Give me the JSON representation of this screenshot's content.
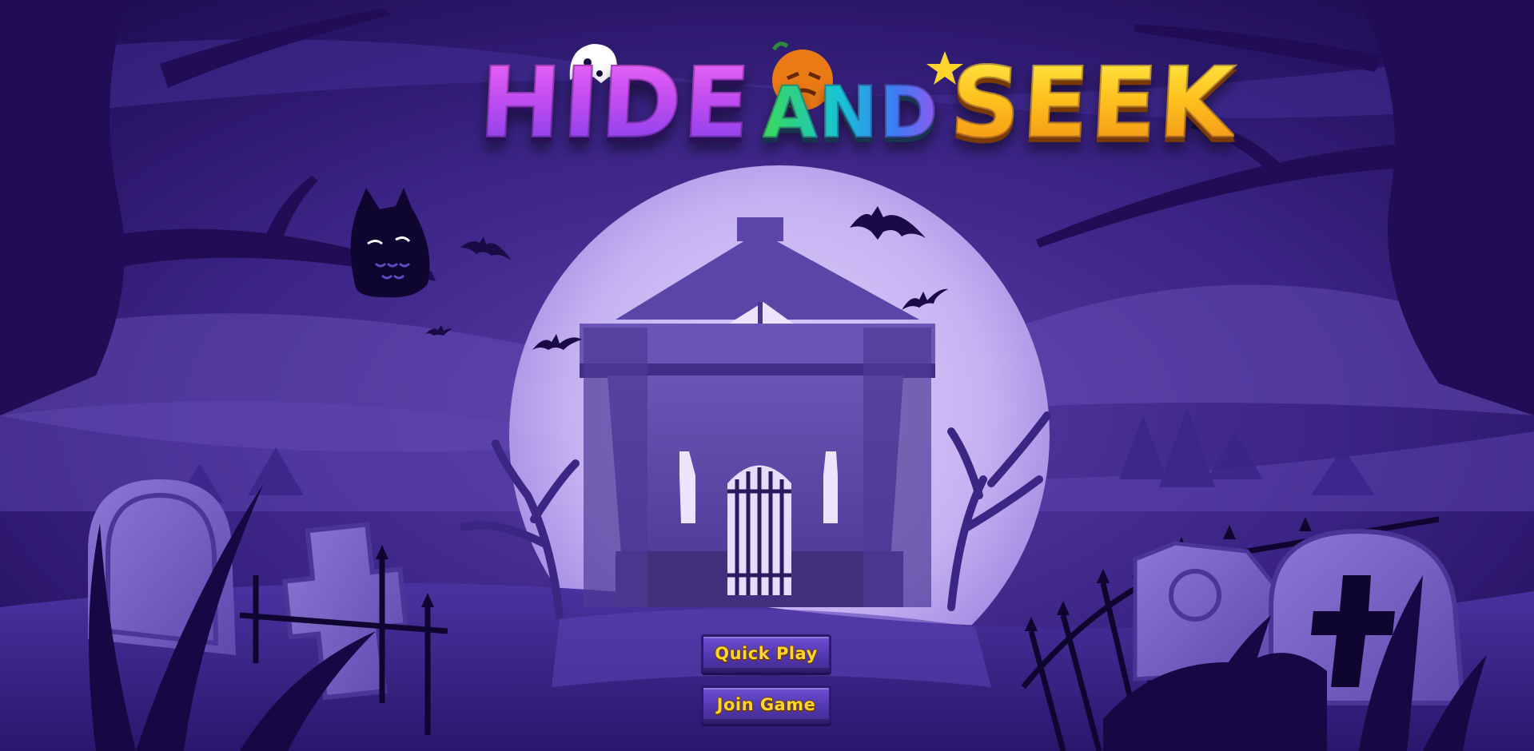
{
  "title": {
    "word1": "HIDE",
    "word2": "AND",
    "word3": "SEEK"
  },
  "menu": {
    "quick_play_label": "Quick Play",
    "join_game_label": "Join Game"
  },
  "colors": {
    "sky": "#1d0b4a",
    "moon": "#c8b4f3",
    "button_fill": "#5338b0",
    "button_text": "#ffd52e"
  },
  "icons": [
    "ghost-icon",
    "pumpkin-icon",
    "star-icon",
    "owl-icon",
    "bat-icon",
    "haunted-house-icon",
    "tombstone-icon",
    "cross-tombstone-icon"
  ]
}
